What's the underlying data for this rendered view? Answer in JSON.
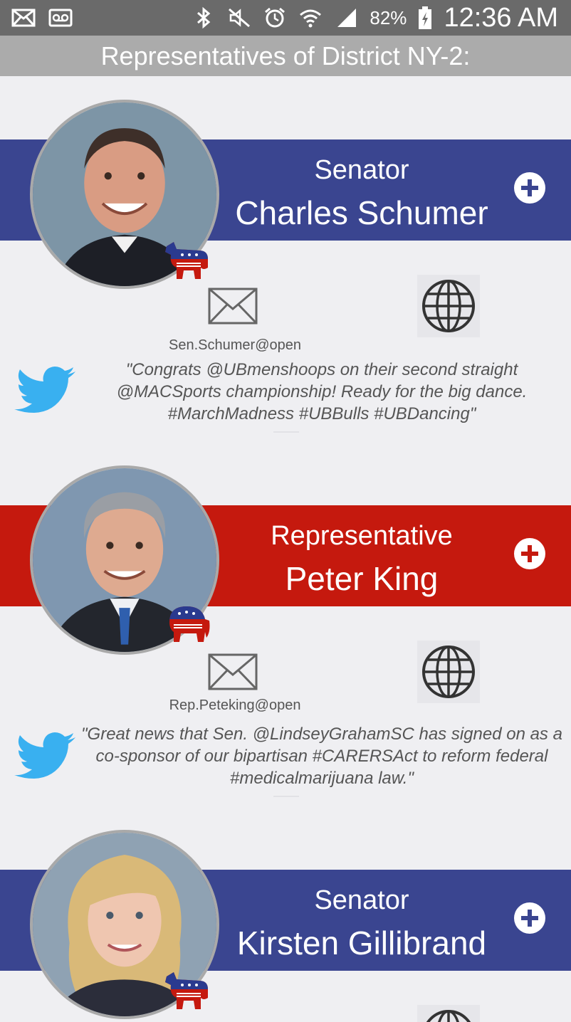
{
  "status_bar": {
    "battery": "82%",
    "time": "12:36 AM"
  },
  "header": {
    "title": "Representatives of District NY-2:"
  },
  "reps": [
    {
      "title": "Senator",
      "name": "Charles Schumer",
      "party": "democrat",
      "email": "Sen.Schumer@open",
      "tweet": "\"Congrats @UBmenshoops on their second straight @MACSports championship! Ready for the big dance. #MarchMadness #UBBulls #UBDancing\""
    },
    {
      "title": "Representative",
      "name": "Peter King",
      "party": "republican",
      "email": "Rep.Peteking@open",
      "tweet": "\"Great news that Sen. @LindseyGrahamSC has signed on as a co-sponsor of our bipartisan #CARERSAct to reform federal #medicalmarijuana law.\""
    },
    {
      "title": "Senator",
      "name": "Kirsten Gillibrand",
      "party": "democrat"
    }
  ],
  "colors": {
    "democrat_banner": "#3a4590",
    "republican_banner": "#c5190e",
    "twitter": "#39b0f0"
  },
  "icons": [
    "email-icon",
    "voicemail-icon",
    "bluetooth-icon",
    "mute-icon",
    "alarm-icon",
    "wifi-icon",
    "signal-icon",
    "battery-icon",
    "plus-icon",
    "envelope-icon",
    "globe-icon",
    "twitter-icon",
    "donkey-icon",
    "elephant-icon"
  ]
}
